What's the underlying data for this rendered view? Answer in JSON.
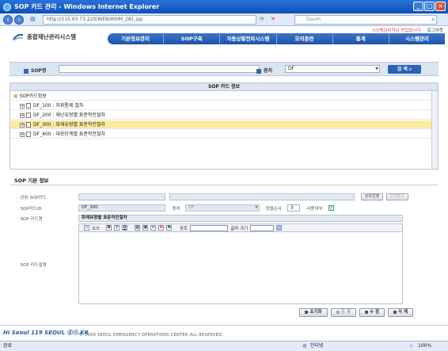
{
  "window": {
    "title": "SOP 카드 관리 - Windows Internet Explorer",
    "url": "http://115.93.73.220/WEB/IM/IM_281.jsp",
    "search_placeholder": "Daum"
  },
  "header": {
    "logo_text": "종합재난관리시스템",
    "top_links": [
      "시스템관리자님 반갑습니다",
      "로그아웃"
    ],
    "nav": [
      "기본정보관리",
      "SOP구축",
      "자동상황전파시스템",
      "모의훈련",
      "통계",
      "시스템관리"
    ]
  },
  "search": {
    "sop_label": "SOP명",
    "sop_value": "",
    "type_label": "종처",
    "type_value": "DF",
    "button_label": "검 색"
  },
  "tree": {
    "title": "SOP 카드 정보",
    "root": "SOP카드정보",
    "items": [
      {
        "label": "DF_100 : 지휘통제 절차",
        "selected": false
      },
      {
        "label": "DF_200 : 재난유형별 표준작전절차",
        "selected": false
      },
      {
        "label": "DF_300 : 화재유형별 표준작전절차",
        "selected": true
      },
      {
        "label": "DF_400 : 대응단계별 표준작전절차",
        "selected": false
      }
    ]
  },
  "detail": {
    "title": "SOP 기본 정보",
    "parent_card_label": "상위 SOP카드",
    "parent_card_value": "",
    "parent_select_button": "상위선택",
    "parent_cancel_button": "선택취소",
    "card_id_label": "SOP카드ID",
    "card_id_value": "DF_300",
    "type_label": "종처",
    "type_value": "DF",
    "order_label": "정렬순서",
    "order_value": "3",
    "use_label": "사용여부",
    "use_checked": true,
    "card_name_label": "SOP 카드명",
    "card_name_value": "화재유형별 표준작전절차",
    "desc_label": "SOP 카드설명",
    "toolbar": {
      "source_label": "소스",
      "font_label": "폰트",
      "size_label": "글자 크기"
    }
  },
  "actions": {
    "reset": "초기화",
    "new": "등 록",
    "save": "수 정",
    "delete": "삭 제"
  },
  "footer": {
    "logo": "Hi Seoul 119 SEOUL ⓖⓞ.KR",
    "copyright": "© 2009 SEOUL EMERGENCY OPERATIONS CENTER ALL RESERVED."
  },
  "status": {
    "left": "완료",
    "zone": "인터넷",
    "zoom": "100%"
  }
}
